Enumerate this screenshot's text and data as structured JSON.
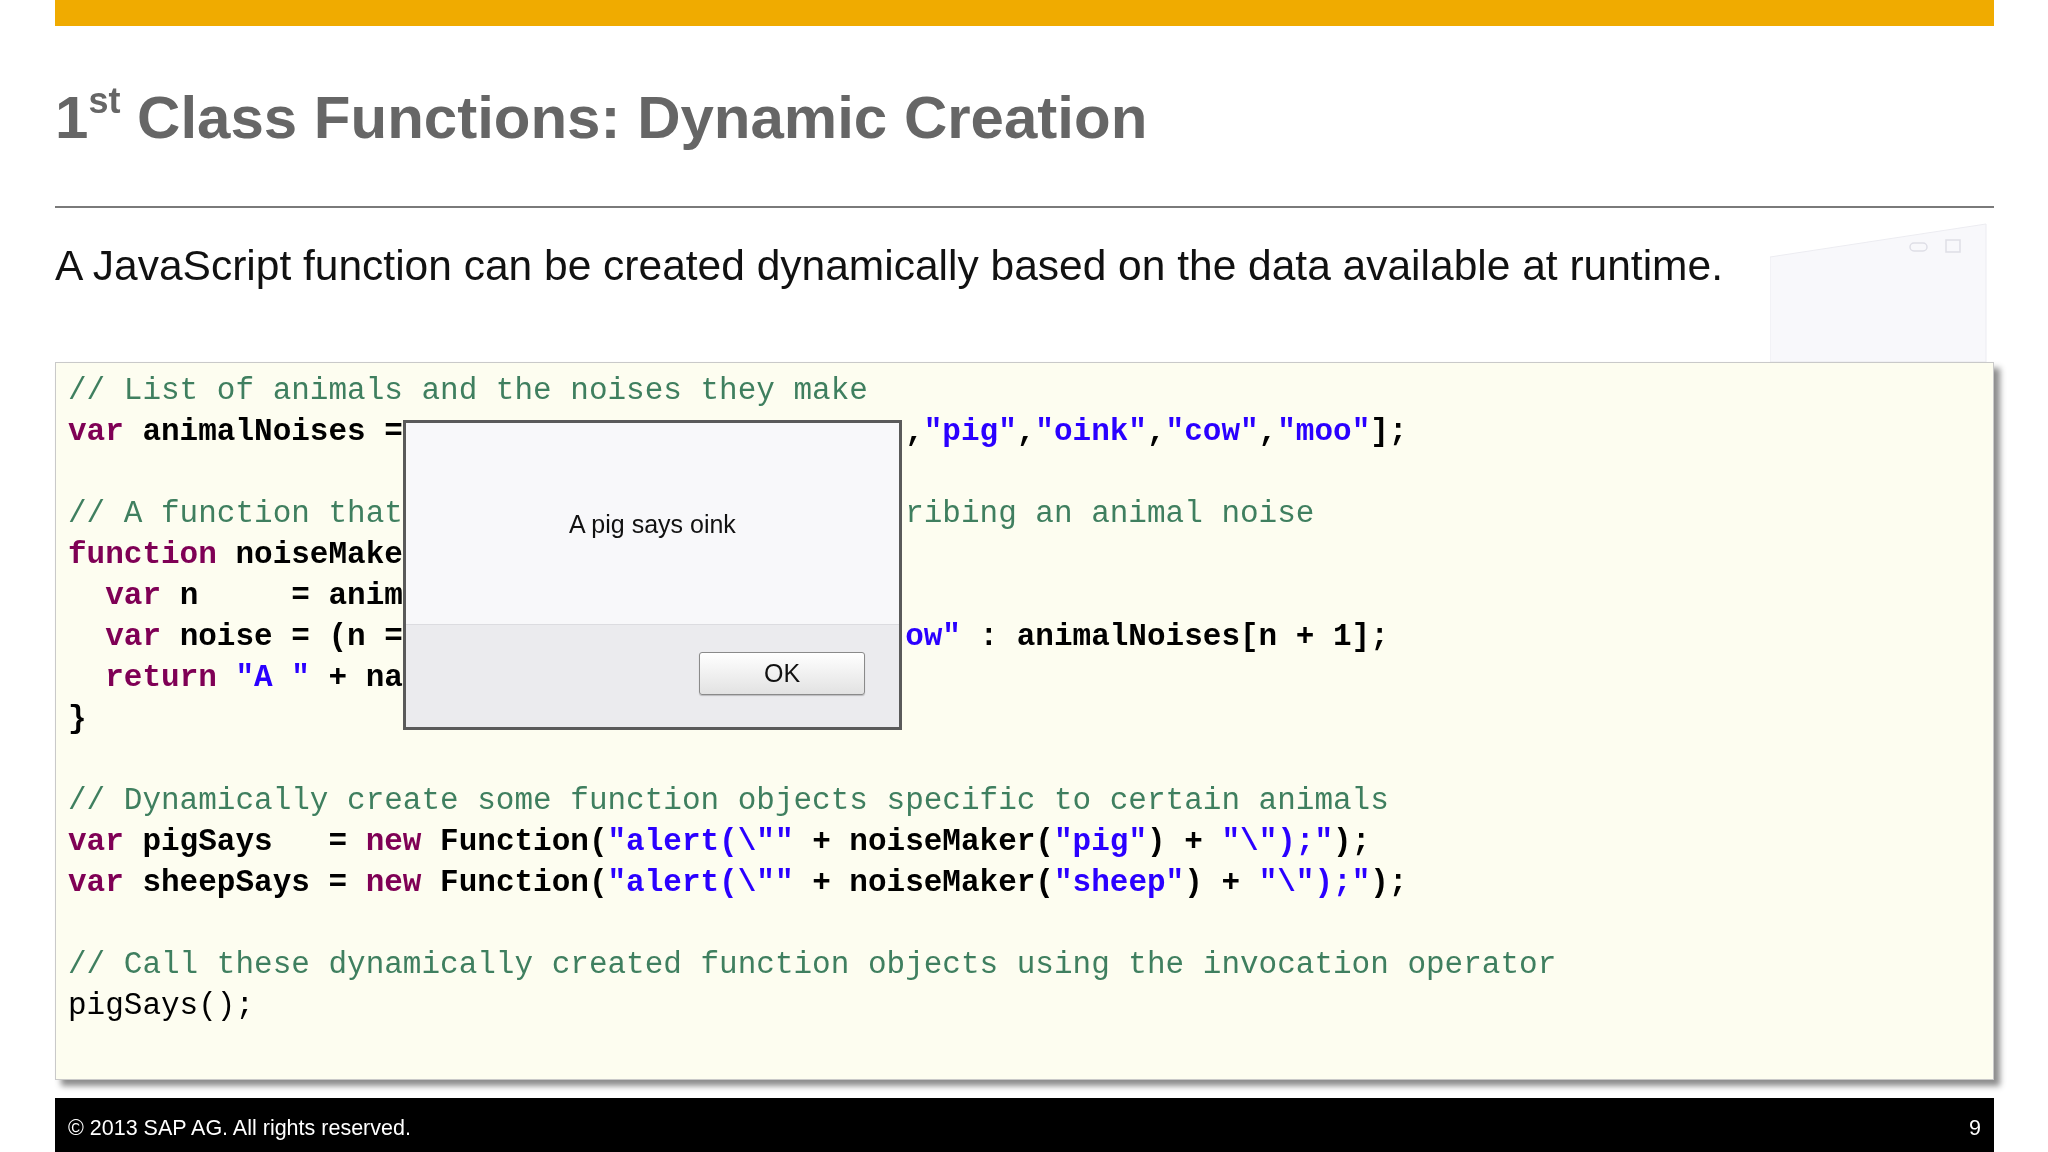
{
  "slide": {
    "title": "1$^{st}$ Class Functions: Dynamic Creation",
    "subtitle": "A JavaScript function can be created dynamically based on the data available at runtime."
  },
  "code": {
    "blocks": [
      {
        "lines": [
          {
            "tokens": [
              {
                "kind": "comment",
                "text": "// List of animals and the noises they make"
              }
            ]
          },
          {
            "tokens": [
              {
                "kind": "keyword",
                "text": "var"
              },
              {
                "kind": "text",
                "text": " animalNoises ="
              }
            ],
            "right_of_alert": [
              {
                "kind": "string",
                "sep": ",",
                "text": "\"pig\""
              },
              {
                "kind": "string",
                "sep": ",",
                "text": "\"oink\""
              },
              {
                "kind": "string",
                "sep": ",",
                "text": "\"cow\""
              },
              {
                "kind": "string",
                "sep": ",",
                "text": "\"moo\""
              },
              {
                "kind": "text",
                "text": "];"
              }
            ]
          }
        ]
      },
      {
        "lines": [
          {
            "tokens": [
              {
                "kind": "comment",
                "text": "// A function that"
              }
            ],
            "right_of_alert": [
              {
                "kind": "comment",
                "text": "ribing an animal noise"
              }
            ]
          },
          {
            "tokens": [
              {
                "kind": "keyword",
                "text": "function"
              },
              {
                "kind": "text",
                "text": " noiseMake"
              }
            ]
          },
          {
            "tokens": [
              {
                "kind": "keyword",
                "text": "  var"
              },
              {
                "kind": "text",
                "text": " n     = anim"
              }
            ]
          },
          {
            "tokens": [
              {
                "kind": "keyword",
                "text": "  var"
              },
              {
                "kind": "text",
                "text": " noise = (n ="
              }
            ],
            "right_of_alert": [
              {
                "kind": "string",
                "text": "ow\""
              },
              {
                "kind": "text",
                "text": " : animalNoises[n + 1];"
              }
            ]
          },
          {
            "tokens": [
              {
                "kind": "keyword",
                "text": "  return"
              },
              {
                "kind": "string",
                "text": " \"A \""
              },
              {
                "kind": "text",
                "text": " + na"
              }
            ]
          },
          {
            "tokens": [
              {
                "kind": "text",
                "text": "}"
              }
            ]
          }
        ]
      },
      {
        "lines": [
          {
            "tokens": [
              {
                "kind": "comment",
                "text": "// Dynamically create some function objects specific to certain animals"
              }
            ]
          },
          {
            "tokens": [
              {
                "kind": "keyword",
                "text": "var"
              },
              {
                "kind": "text",
                "text": " pigSays   = "
              },
              {
                "kind": "keyword",
                "text": "new"
              },
              {
                "kind": "text",
                "text": " Function("
              },
              {
                "kind": "string",
                "text": "\"alert(\\\"\""
              },
              {
                "kind": "text",
                "text": " + noiseMaker("
              },
              {
                "kind": "string",
                "text": "\"pig\""
              },
              {
                "kind": "text",
                "text": ") + "
              },
              {
                "kind": "string",
                "text": "\"\\\");\""
              },
              {
                "kind": "text",
                "text": ");"
              }
            ]
          },
          {
            "tokens": [
              {
                "kind": "keyword",
                "text": "var"
              },
              {
                "kind": "text",
                "text": " sheepSays = "
              },
              {
                "kind": "keyword",
                "text": "new"
              },
              {
                "kind": "text",
                "text": " Function("
              },
              {
                "kind": "string",
                "text": "\"alert(\\\"\""
              },
              {
                "kind": "text",
                "text": " + noiseMaker("
              },
              {
                "kind": "string",
                "text": "\"sheep\""
              },
              {
                "kind": "text",
                "text": ") + "
              },
              {
                "kind": "string",
                "text": "\"\\\");\""
              },
              {
                "kind": "text",
                "text": ");"
              }
            ]
          }
        ]
      },
      {
        "lines": [
          {
            "tokens": [
              {
                "kind": "comment",
                "text": "// Call these dynamically created function objects using the invocation operator"
              }
            ]
          },
          {
            "tokens": [
              {
                "kind": "plain",
                "text": "pigSays();"
              }
            ]
          }
        ]
      }
    ]
  },
  "alert": {
    "message": "A pig says oink",
    "button": "OK"
  },
  "footer": {
    "copyright": "© 2013 SAP AG. All rights reserved.",
    "page": "9"
  }
}
